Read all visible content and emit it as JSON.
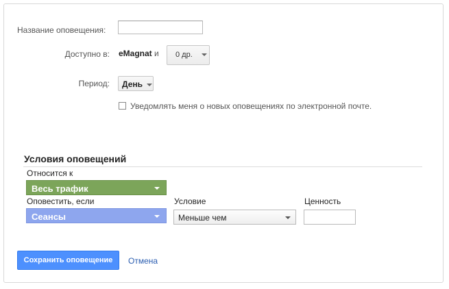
{
  "form": {
    "name_label": "Название оповещения:",
    "name_value": "",
    "available_label": "Доступно в:",
    "account": "eMagnat",
    "and_label": "и",
    "other_views": "0 др.",
    "period_label": "Период:",
    "period_value": "День",
    "email_checkbox_label": "Уведомлять меня о новых оповещениях по электронной почте.",
    "email_checked": false
  },
  "conditions": {
    "title": "Условия оповещений",
    "applies_to_label": "Относится к",
    "applies_to_value": "Весь трафик",
    "alert_if_label": "Оповестить, если",
    "alert_if_value": "Сеансы",
    "condition_label": "Условие",
    "condition_value": "Меньше чем",
    "value_label": "Ценность",
    "value_value": ""
  },
  "actions": {
    "save_label": "Сохранить оповещение",
    "cancel_label": "Отмена"
  },
  "colors": {
    "applies_to_bar": "#7ca55a",
    "metric_bar": "#8ea6ee",
    "primary_button": "#4d90fe",
    "link": "#2a5db0"
  }
}
